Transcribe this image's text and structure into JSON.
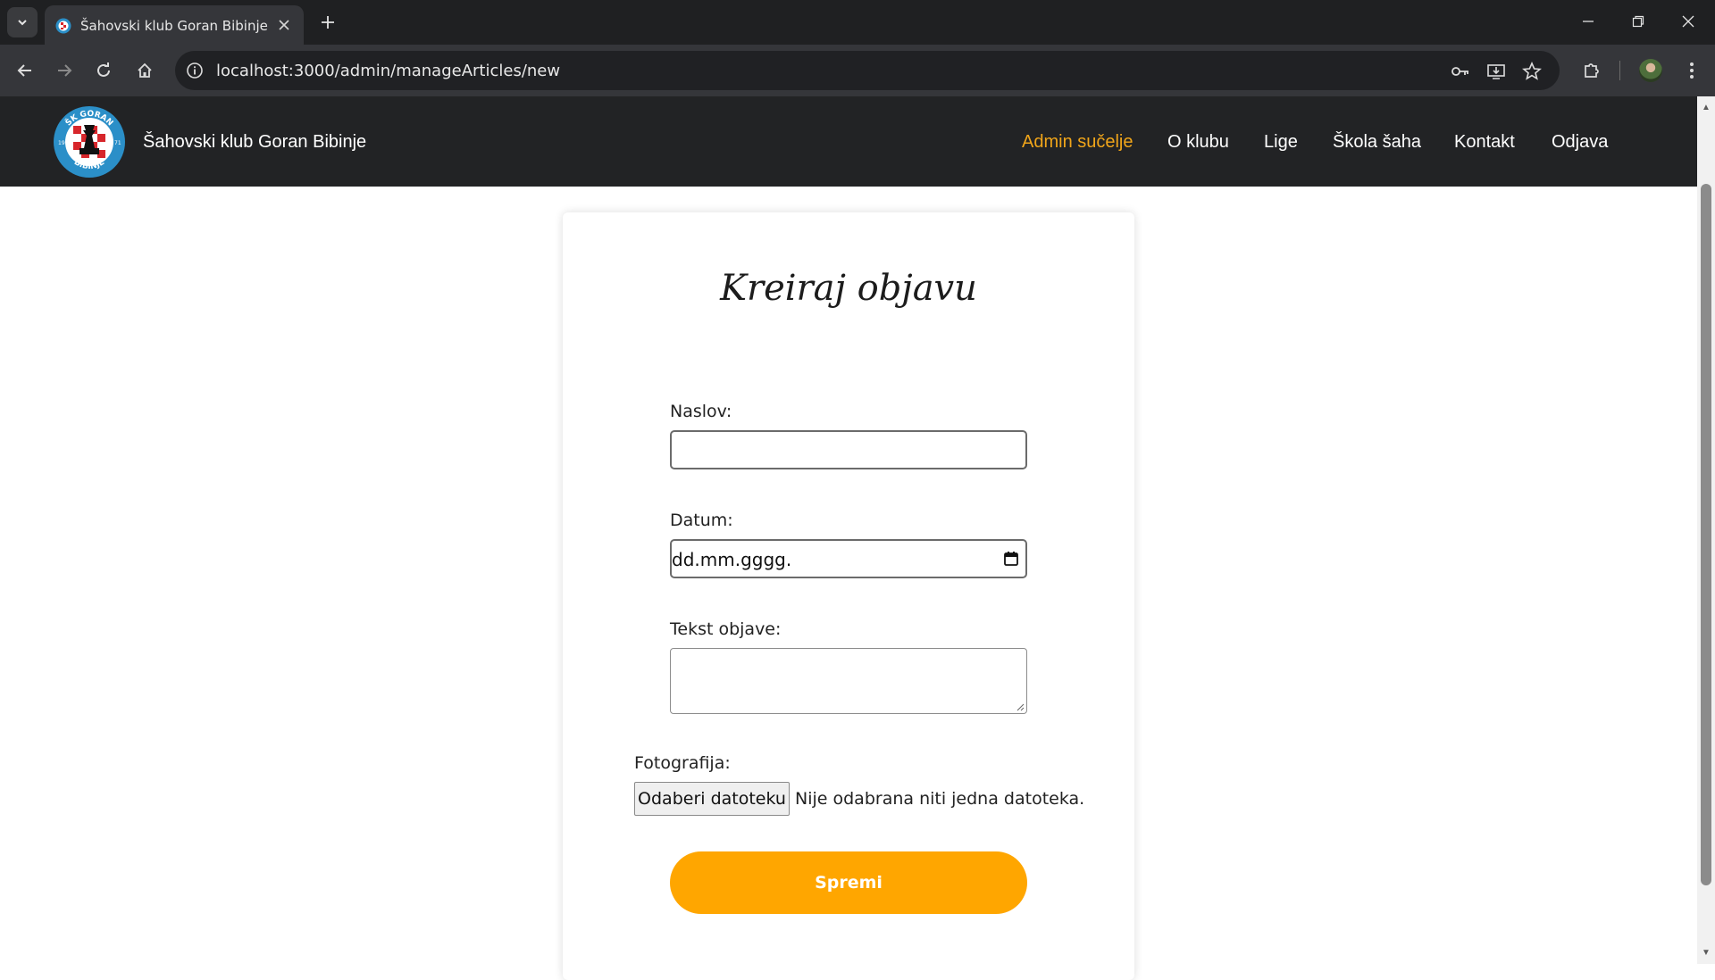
{
  "browser": {
    "tab_title": "Šahovski klub Goran Bibinje",
    "url": "localhost:3000/admin/manageArticles/new"
  },
  "header": {
    "site_title": "Šahovski klub Goran Bibinje",
    "logo_text_top": "ŠK GORAN",
    "logo_text_bottom": "BIBINJE",
    "logo_year_left": "19",
    "logo_year_right": "71",
    "nav": [
      {
        "label": "Admin sučelje",
        "active": true
      },
      {
        "label": "O klubu",
        "active": false
      },
      {
        "label": "Lige",
        "active": false
      },
      {
        "label": "Škola šaha",
        "active": false
      },
      {
        "label": "Kontakt",
        "active": false
      },
      {
        "label": "Odjava",
        "active": false
      }
    ]
  },
  "form": {
    "title": "Kreiraj objavu",
    "title_label": "Naslov:",
    "title_value": "",
    "date_label": "Datum:",
    "date_value": "dd.mm.gggg.",
    "text_label": "Tekst objave:",
    "text_value": "",
    "photo_label": "Fotografija:",
    "file_button": "Odaberi datoteku",
    "file_status": "Nije odabrana niti jedna datoteka.",
    "submit": "Spremi"
  },
  "colors": {
    "header_bg": "#222325",
    "accent": "#ffa600",
    "active_nav": "#f0a51a"
  }
}
